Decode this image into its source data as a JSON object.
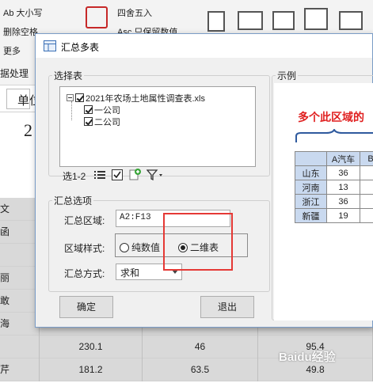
{
  "ribbon": {
    "case_label": "Ab 大小写",
    "delete_spaces_label": "删除空格",
    "more_label": "更多",
    "processing_label": "据处理",
    "round_label": "四舍五入",
    "keep_value_label": "Asc 只保留数值"
  },
  "sheet": {
    "unit_fragment": "单位",
    "big_number_fragment": "2",
    "left_chars": [
      "文",
      "函",
      "",
      "丽",
      "敢",
      "海",
      "",
      "芹"
    ],
    "rows": [
      {
        "c1": "",
        "c2": "",
        "c3": ""
      },
      {
        "c1": "",
        "c2": "",
        "c3": ""
      },
      {
        "c1": "",
        "c2": "",
        "c3": ""
      },
      {
        "c1": "",
        "c2": "",
        "c3": ""
      },
      {
        "c1": "",
        "c2": "",
        "c3": ""
      },
      {
        "c1": "02.0",
        "c2": "41.7",
        "c3": "21.0"
      },
      {
        "c1": "230.1",
        "c2": "46",
        "c3": "95.4"
      },
      {
        "c1": "181.2",
        "c2": "63.5",
        "c3": "49.8"
      }
    ]
  },
  "dialog": {
    "title": "汇总多表",
    "select_table_legend": "选择表",
    "tree": {
      "root": "2021年农场土地属性调查表.xls",
      "children": [
        "一公司",
        "二公司"
      ]
    },
    "selected_count": "选1-2",
    "options_legend": "汇总选项",
    "range_label": "汇总区域:",
    "range_value": "A2:F13",
    "style_label": "区域样式:",
    "style_options": [
      "纯数值",
      "二维表"
    ],
    "style_selected": "二维表",
    "method_label": "汇总方式:",
    "method_value": "求和",
    "ok_label": "确定",
    "exit_label": "退出",
    "example_legend": "示例",
    "example": {
      "caption": "多个此区域的",
      "header": [
        "",
        "A汽车",
        "B"
      ],
      "rows": [
        [
          "山东",
          "36",
          ""
        ],
        [
          "河南",
          "13",
          ""
        ],
        [
          "浙江",
          "36",
          ""
        ],
        [
          "新疆",
          "19",
          ""
        ]
      ]
    }
  },
  "watermark": "Baidu经验"
}
